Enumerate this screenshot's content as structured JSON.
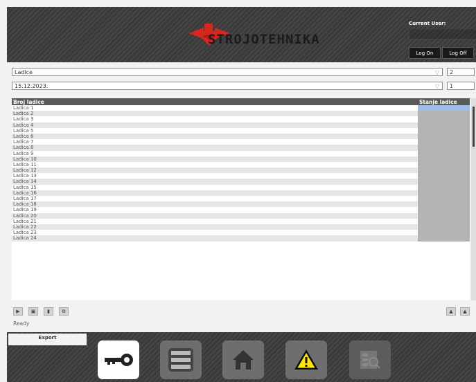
{
  "header": {
    "brand": "STROJOTEHNIKA",
    "current_user_label": "Current User:",
    "current_user_value": "",
    "logon_label": "Log On",
    "logoff_label": "Log Off"
  },
  "filters": {
    "type_value": "Ladice",
    "type_number": "2",
    "date_value": "15.12.2023.",
    "date_number": "1"
  },
  "grid": {
    "col_broj": "Broj ladice",
    "col_stanje": "Stanje ladice",
    "rows": [
      "Ladica 1",
      "Ladica 2",
      "Ladica 3",
      "Ladica 4",
      "Ladica 5",
      "Ladica 6",
      "Ladica 7",
      "Ladica 8",
      "Ladica 9",
      "Ladica 10",
      "Ladica 11",
      "Ladica 12",
      "Ladica 13",
      "Ladica 14",
      "Ladica 15",
      "Ladica 16",
      "Ladica 17",
      "Ladica 18",
      "Ladica 19",
      "Ladica 20",
      "Ladica 21",
      "Ladica 22",
      "Ladica 23",
      "Ladica 24"
    ]
  },
  "status": "Ready",
  "export_label": "Export",
  "icons": {
    "nav": [
      "key-icon",
      "list-icon",
      "home-icon",
      "warning-icon",
      "report-icon"
    ]
  },
  "colors": {
    "logo_red": "#d8261f",
    "selected_cell": "#9dbde9",
    "warning_yellow": "#ffe600"
  }
}
